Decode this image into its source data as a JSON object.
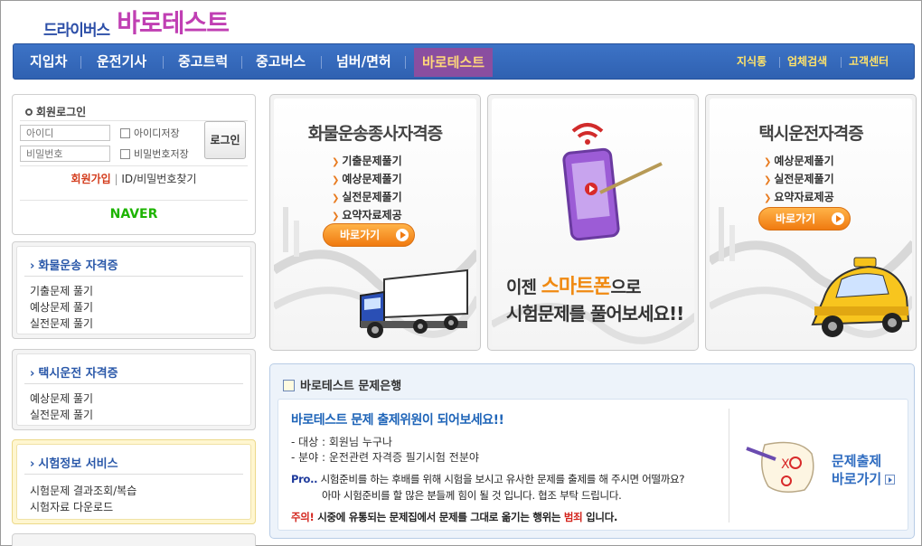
{
  "logo": {
    "small": "드라이버스",
    "big": "바로테스트"
  },
  "nav": {
    "items": [
      "지입차",
      "운전기사",
      "중고트럭",
      "중고버스",
      "넘버/면허",
      "바로테스트"
    ],
    "util": [
      "지식통",
      "업체검색",
      "고객센터"
    ]
  },
  "login": {
    "title": "회원로그인",
    "id_placeholder": "아이디",
    "pw_placeholder": "비밀번호",
    "save_id": "아이디저장",
    "save_pw": "비밀번호저장",
    "login_button": "로그인",
    "join": "회원가입",
    "separator": " | ",
    "find": "ID/비밀번호찾기",
    "naver": "NAVER"
  },
  "sidebar": {
    "cargo": {
      "title": "화물운송 자격증",
      "items": [
        "기출문제 풀기",
        "예상문제 풀기",
        "실전문제 풀기"
      ]
    },
    "taxi": {
      "title": "택시운전 자격증",
      "items": [
        "예상문제 풀기",
        "실전문제 풀기"
      ]
    },
    "exam": {
      "title": "시험정보 서비스",
      "items": [
        "시험문제 결과조회/복습",
        "시험자료 다운로드"
      ]
    }
  },
  "banners": {
    "cargo": {
      "title": "화물운송종사자격증",
      "items": [
        "기출문제풀기",
        "예상문제풀기",
        "실전문제풀기",
        "요약자료제공"
      ],
      "button": "바로가기"
    },
    "smart": {
      "line1_pre": "이젠 ",
      "line1_hl": "스마트폰",
      "line1_post": "으로",
      "line2": "시험문제를 풀어보세요!!"
    },
    "taxi": {
      "title": "택시운전자격증",
      "items": [
        "예상문제풀기",
        "실전문제풀기",
        "요약자료제공"
      ],
      "button": "바로가기"
    }
  },
  "bank": {
    "title": "바로테스트 문제은행",
    "headline": "바로테스트 문제 출제위원이 되어보세요!!",
    "target": "- 대상 : 회원님 누구나",
    "field": "- 분야 : 운전관련 자격증 필기시험 전분야",
    "pro_label": "Pro..",
    "pro_text1": " 시험준비를 하는 후배를 위해 시험을 보시고 유사한 문제를 출제를 해 주시면 어떨까요?",
    "pro_text2": "아마 시험준비를 할 많은 분들께 힘이 될 것 입니다. 협조 부탁 드립니다.",
    "warn_label": "주의!",
    "warn_text": " 시중에 유통되는 문제집에서 문제를 그대로 옮기는 행위는 ",
    "warn_hl": "범죄",
    "warn_end": " 입니다.",
    "apply_line1": "문제출제",
    "apply_line2": "바로가기"
  },
  "colors": {
    "nav_blue": "#3568b8",
    "accent_orange": "#f08a12",
    "brand_purple": "#c03fb3",
    "link_blue": "#1e64b8"
  }
}
